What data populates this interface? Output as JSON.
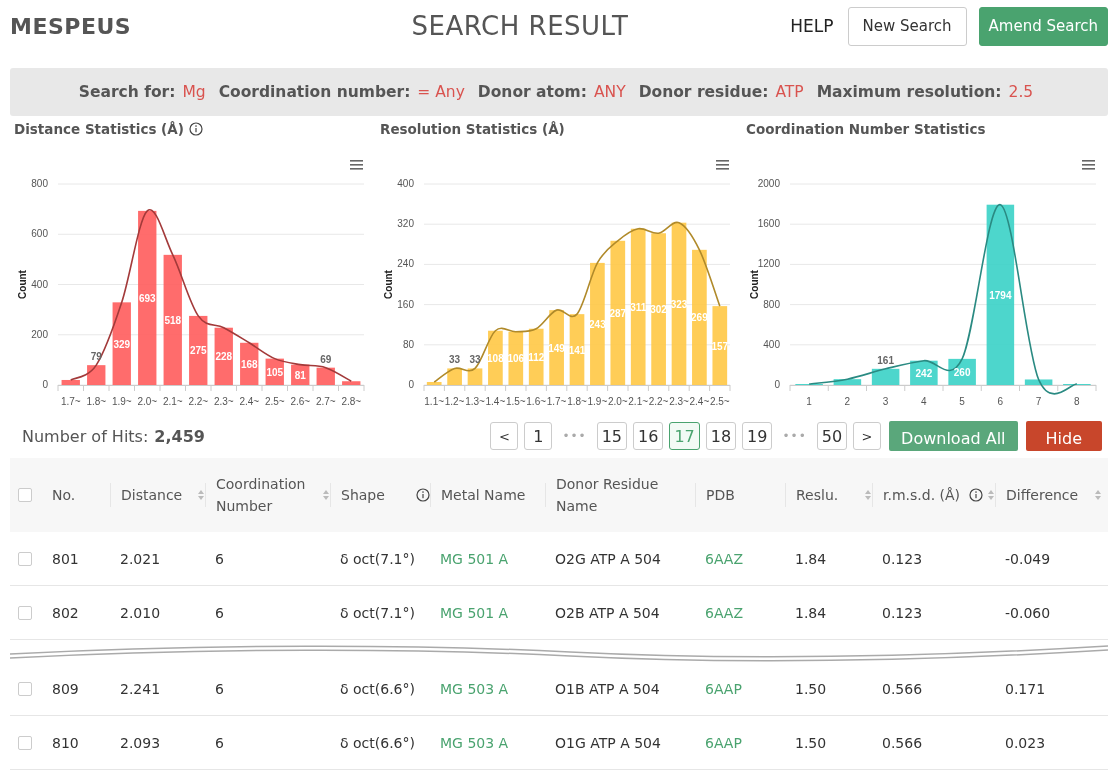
{
  "header": {
    "logo": "MESPEUS",
    "title": "SEARCH RESULT",
    "help": "HELP",
    "buttons": [
      {
        "label": "New Search",
        "kind": "outline"
      },
      {
        "label": "Amend Search",
        "kind": "primary"
      }
    ]
  },
  "search_for": [
    {
      "label": "Search for:",
      "value": "Mg"
    },
    {
      "label": "Coordination number:",
      "value": "= Any"
    },
    {
      "label": "Donor atom:",
      "value": "ANY"
    },
    {
      "label": "Donor residue:",
      "value": "ATP"
    },
    {
      "label": "Maximum resolution:",
      "value": "2.5"
    }
  ],
  "charts": [
    {
      "info": true,
      "chart_data": {
        "type": "bar",
        "title": "Distance Statistics (Å)",
        "ylabel": "Count",
        "categories": [
          "1.7~",
          "1.8~",
          "1.9~",
          "2.0~",
          "2.1~",
          "2.2~",
          "2.3~",
          "2.4~",
          "2.5~",
          "2.6~",
          "2.7~",
          "2.8~"
        ],
        "ylim": [
          0,
          800
        ],
        "yticks": [
          0,
          200,
          400,
          600,
          800
        ],
        "grid": true,
        "value_labels": [
          null,
          "79",
          "329",
          "693",
          "518",
          "275",
          "228",
          "168",
          "105",
          "81",
          "69",
          null
        ],
        "series": [
          {
            "type": "bar",
            "color": "#ff5c5c",
            "values": [
              20,
              79,
              329,
              693,
              518,
              275,
              228,
              168,
              105,
              81,
              69,
              15
            ]
          },
          {
            "type": "line",
            "color": "#a33a3a",
            "values": [
              20,
              79,
              329,
              693,
              518,
              275,
              228,
              168,
              105,
              81,
              69,
              15
            ]
          }
        ]
      }
    },
    {
      "info": false,
      "chart_data": {
        "type": "bar",
        "title": "Resolution Statistics (Å)",
        "ylabel": "Count",
        "categories": [
          "1.1~",
          "1.2~",
          "1.3~",
          "1.4~",
          "1.5~",
          "1.6~",
          "1.7~",
          "1.8~",
          "1.9~",
          "2.0~",
          "2.1~",
          "2.2~",
          "2.3~",
          "2.4~",
          "2.5~"
        ],
        "ylim": [
          0,
          400
        ],
        "yticks": [
          0,
          80,
          160,
          240,
          320,
          400
        ],
        "grid": true,
        "value_labels": [
          null,
          "33",
          "33",
          "108",
          "106",
          "112",
          "149",
          "141",
          "243",
          "287",
          "311",
          "302",
          "323",
          "269",
          "157"
        ],
        "series": [
          {
            "type": "bar",
            "color": "#ffc845",
            "values": [
              6,
              33,
              33,
              108,
              106,
              112,
              149,
              141,
              243,
              287,
              311,
              302,
              323,
              269,
              157
            ]
          },
          {
            "type": "line",
            "color": "#b08a2a",
            "values": [
              6,
              33,
              33,
              108,
              106,
              112,
              149,
              141,
              243,
              287,
              311,
              302,
              323,
              269,
              157
            ]
          }
        ]
      }
    },
    {
      "info": false,
      "chart_data": {
        "type": "bar",
        "title": "Coordination Number Statistics",
        "ylabel": "Count",
        "categories": [
          "1",
          "2",
          "3",
          "4",
          "5",
          "6",
          "7",
          "8"
        ],
        "ylim": [
          0,
          2000
        ],
        "yticks": [
          0,
          400,
          800,
          1200,
          1600,
          2000
        ],
        "grid": true,
        "value_labels": [
          null,
          null,
          "161",
          "242",
          "260",
          "1794",
          null,
          null
        ],
        "series": [
          {
            "type": "bar",
            "color": "#3ad1c6",
            "values": [
              10,
              58,
              161,
              242,
              260,
              1794,
              55,
              10
            ]
          },
          {
            "type": "line",
            "color": "#2a8a82",
            "values": [
              10,
              58,
              161,
              242,
              260,
              1794,
              55,
              10
            ]
          }
        ]
      }
    }
  ],
  "hits": {
    "label": "Number of Hits:",
    "value": "2,459"
  },
  "pagination": [
    {
      "kind": "prev",
      "label": "<"
    },
    {
      "kind": "page",
      "label": "1",
      "selected": false
    },
    {
      "kind": "ellipsis",
      "label": "•••"
    },
    {
      "kind": "page",
      "label": "15",
      "selected": false
    },
    {
      "kind": "page",
      "label": "16",
      "selected": false
    },
    {
      "kind": "page",
      "label": "17",
      "selected": true
    },
    {
      "kind": "page",
      "label": "18",
      "selected": false
    },
    {
      "kind": "page",
      "label": "19",
      "selected": false
    },
    {
      "kind": "ellipsis",
      "label": "•••"
    },
    {
      "kind": "page",
      "label": "50",
      "selected": false
    },
    {
      "kind": "next",
      "label": ">"
    }
  ],
  "actions": [
    {
      "label": "Download All",
      "kind": "download"
    },
    {
      "label": "Hide",
      "kind": "hide"
    }
  ],
  "table": {
    "select_all": {
      "checked": false
    },
    "columns": [
      {
        "label": "No.",
        "sortable": false,
        "info": false
      },
      {
        "label": "Distance",
        "sortable": true,
        "info": false
      },
      {
        "label": "Coordination Number",
        "sortable": true,
        "info": false
      },
      {
        "label": "Shape",
        "sortable": false,
        "info": true
      },
      {
        "label": "Metal Name",
        "sortable": false,
        "info": false
      },
      {
        "label": "Donor Residue Name",
        "sortable": false,
        "info": false
      },
      {
        "label": "PDB",
        "sortable": false,
        "info": false
      },
      {
        "label": "Reslu.",
        "sortable": true,
        "info": false
      },
      {
        "label": "r.m.s.d. (Å)",
        "sortable": true,
        "info": true
      },
      {
        "label": "Difference",
        "sortable": true,
        "info": false
      }
    ],
    "rows": [
      {
        "checked": false,
        "break_after": false,
        "cells": [
          "801",
          "2.021",
          "6",
          "δ oct(7.1°)",
          "MG 501 A",
          "O2G ATP A 504",
          "6AAZ",
          "1.84",
          "0.123",
          "-0.049"
        ]
      },
      {
        "checked": false,
        "break_after": true,
        "cells": [
          "802",
          "2.010",
          "6",
          "δ oct(7.1°)",
          "MG 501 A",
          "O2B ATP A 504",
          "6AAZ",
          "1.84",
          "0.123",
          "-0.060"
        ]
      },
      {
        "checked": false,
        "break_after": false,
        "cells": [
          "809",
          "2.241",
          "6",
          "δ oct(6.6°)",
          "MG 503 A",
          "O1B ATP A 504",
          "6AAP",
          "1.50",
          "0.566",
          "0.171"
        ]
      },
      {
        "checked": false,
        "break_after": false,
        "cells": [
          "810",
          "2.093",
          "6",
          "δ oct(6.6°)",
          "MG 503 A",
          "O1G ATP A 504",
          "6AAP",
          "1.50",
          "0.566",
          "0.023"
        ]
      }
    ]
  }
}
